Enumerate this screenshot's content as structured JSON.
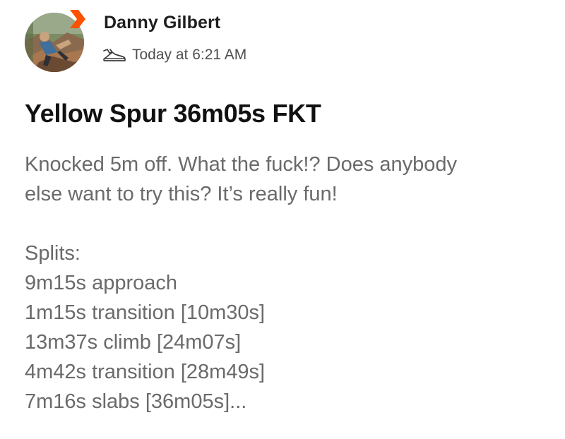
{
  "post": {
    "author": "Danny Gilbert",
    "timestamp": "Today at 6:21 AM",
    "activity_icon": "shoe-icon",
    "brand_color": "#fc5200",
    "title": "Yellow Spur 36m05s FKT",
    "description_lines": [
      "Knocked 5m off. What the fuck!? Does anybody",
      "else want to try this? It’s really fun!"
    ],
    "splits_heading": "Splits:",
    "splits": [
      "9m15s approach",
      "1m15s transition [10m30s]",
      "13m37s climb [24m07s]",
      "4m42s transition [28m49s]",
      "7m16s slabs [36m05s]..."
    ]
  }
}
